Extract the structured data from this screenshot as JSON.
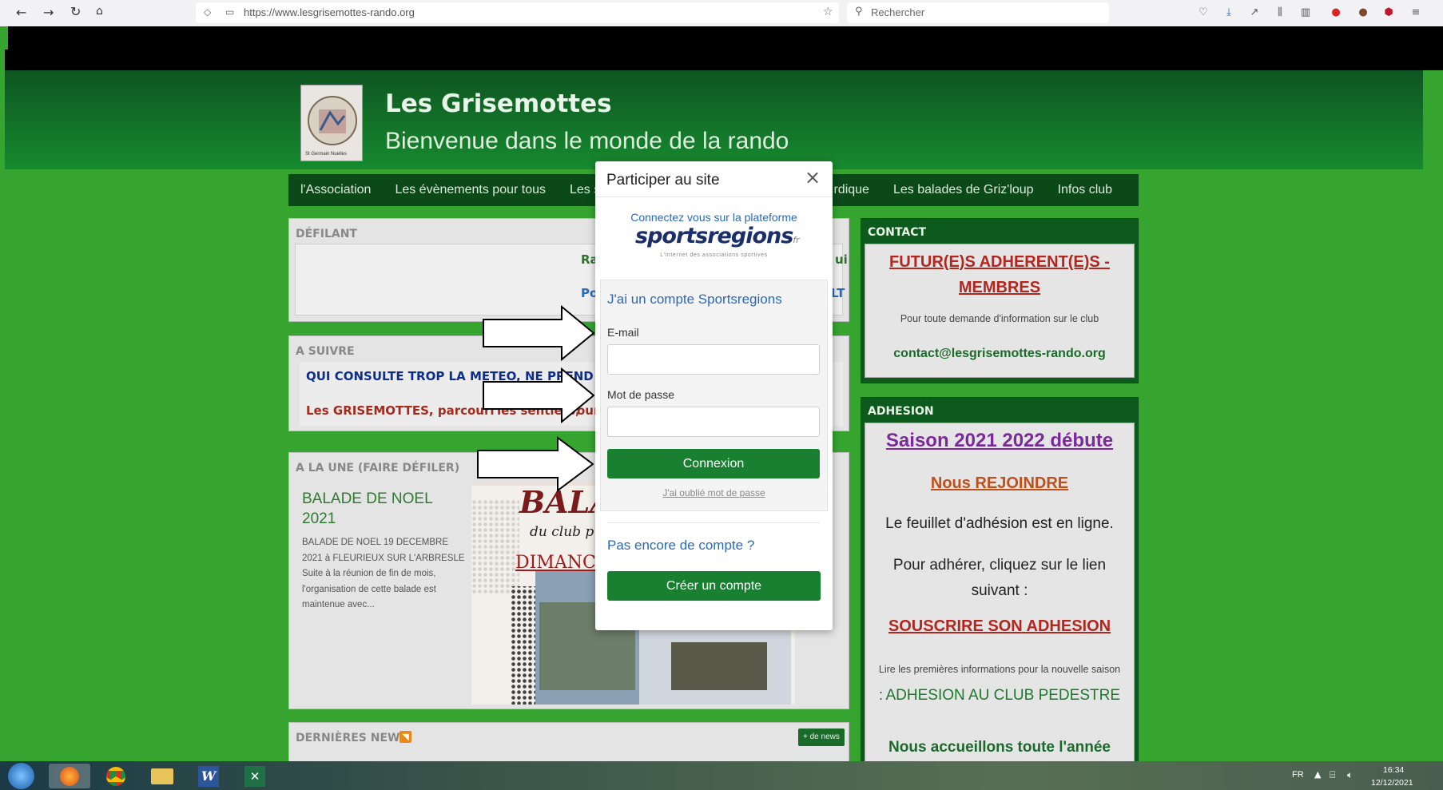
{
  "browser": {
    "url": "https://www.lesgrisemottes-rando.org",
    "search_placeholder": "Rechercher"
  },
  "site": {
    "logo_text": "St Germain Nuelles",
    "title": "Les Grisemottes",
    "subtitle": "Bienvenue dans le monde de la rando"
  },
  "menu": {
    "items": [
      "l'Association",
      "Les évènements pour tous",
      "Les sorti",
      "rdique",
      "Les balades de Griz'loup",
      "Infos club"
    ]
  },
  "defilant": {
    "heading": "DÉFILANT",
    "line1": "Ra",
    "line1_tail": "ui",
    "line2": "Po",
    "line2_tail": "LT"
  },
  "a_suivre": {
    "heading": "A SUIVRE",
    "line1": "QUI CONSULTE TROP LA METEO, NE PREND JA",
    "line2": "Les GRISEMOTTES, parcouri",
    "line2_mid": "les sentiers,",
    "line2_tail": "our"
  },
  "a_la_une": {
    "heading": "A LA UNE (FAIRE DÉFILER)",
    "news_title": "BALADE DE NOEL 2021",
    "news_text": "BALADE DE NOEL 19 DECEMBRE 2021 à FLEURIEUX SUR L'ARBRESLE Suite à la réunion de fin de mois, l'organisation de cette balade est maintenue avec...",
    "poster_title": "BALA",
    "poster_sub": "du club p",
    "poster_date": "DIMANC"
  },
  "dernieres_news": {
    "heading": "DERNIÈRES NEWS",
    "more_link": "+ de news"
  },
  "contact": {
    "heading": "CONTACT",
    "title": "FUTUR(E)S ADHERENT(E)S - MEMBRES",
    "text": "Pour toute demande d'information sur le club",
    "email": "contact@lesgrisemottes-rando.org"
  },
  "adhesion": {
    "heading": "ADHESION",
    "season": "Saison 2021 2022 débute",
    "join": "Nous REJOINDRE",
    "p1": "Le feuillet d'adhésion est en ligne.",
    "p2": "Pour adhérer, cliquez sur le lien suivant :",
    "subscribe": "SOUSCRIRE SON ADHESION",
    "p3_small": "Lire les premières informations pour la nouvelle saison",
    "p3_sep": ":",
    "p3_link": "ADHESION AU CLUB PEDESTRE",
    "p4": "Nous accueillons toute l'année"
  },
  "modal": {
    "title": "Participer au site",
    "close": "×",
    "connect_text": "Connectez vous sur la plateforme",
    "brand": "sportsregions",
    "brand_tld": "fr",
    "brand_tagline": "L'internet des associations sportives",
    "account_heading": "J'ai un compte Sportsregions",
    "email_label": "E-mail",
    "password_label": "Mot de passe",
    "login_button": "Connexion",
    "forgot_link": "J'ai oublié mot de passe",
    "no_account": "Pas encore de compte ?",
    "create_button": "Créer un compte"
  },
  "taskbar": {
    "lang": "FR",
    "time": "16:34",
    "date": "12/12/2021"
  },
  "colors": {
    "site_green": "#35a52f",
    "header_dark": "#0d5521",
    "button_green": "#1a8031",
    "link_blue": "#2a6ab5",
    "red_link": "#b3261e",
    "purple_link": "#7a2a9a"
  }
}
